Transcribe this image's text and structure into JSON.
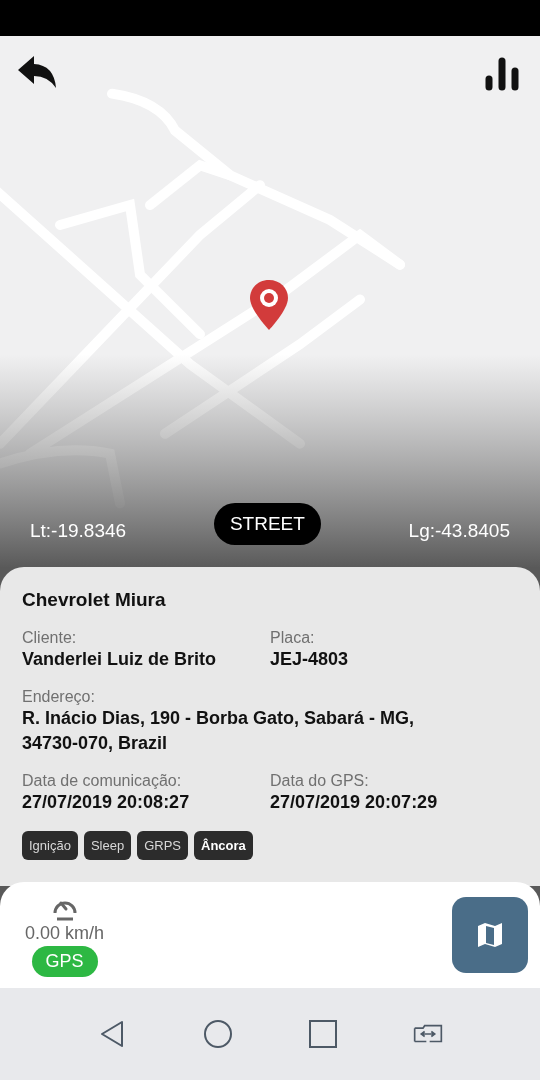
{
  "map": {
    "latitude": "Lt:-19.8346",
    "longitude": "Lg:-43.8405",
    "layer_button": "STREET"
  },
  "vehicle": {
    "name": "Chevrolet Miura",
    "fields": [
      {
        "label": "Cliente:",
        "value": "Vanderlei Luiz de Brito",
        "wide": false
      },
      {
        "label": "Placa:",
        "value": "JEJ-4803",
        "wide": false
      },
      {
        "label": "Endereço:",
        "value": "R. Inácio Dias, 190 - Borba Gato, Sabará - MG, 34730-070, Brazil",
        "wide": true
      },
      {
        "label": "Data de comunicação:",
        "value": "27/07/2019 20:08:27",
        "wide": false
      },
      {
        "label": "Data do GPS:",
        "value": "27/07/2019 20:07:29",
        "wide": false
      }
    ],
    "tags": [
      {
        "label": "Ignição",
        "on": false
      },
      {
        "label": "Sleep",
        "on": false
      },
      {
        "label": "GRPS",
        "on": false
      },
      {
        "label": "Âncora",
        "on": true
      }
    ]
  },
  "footer": {
    "speed": "0.00 km/h",
    "gps": {
      "label": "GPS",
      "on": true
    }
  }
}
